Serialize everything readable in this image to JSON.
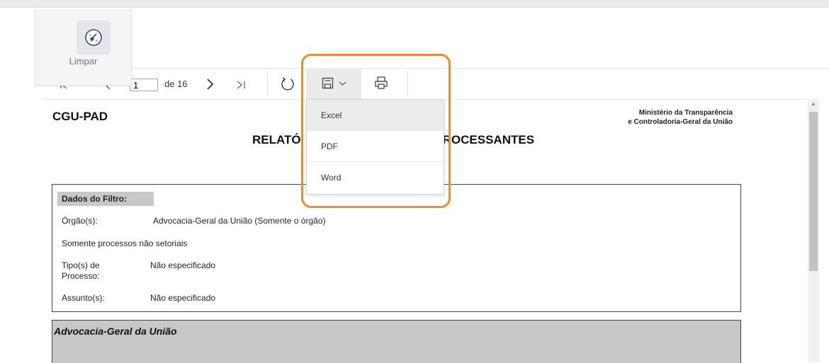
{
  "limpar": {
    "label": "Limpar",
    "icon": "broom-clean-icon"
  },
  "toolbar": {
    "current_page": "1",
    "total_pages": "de 16",
    "icons": [
      "first-page-icon",
      "prev-page-icon",
      "next-page-icon",
      "last-page-icon",
      "refresh-icon",
      "save-icon",
      "chevron-down-icon",
      "print-icon"
    ]
  },
  "export_menu": {
    "items": [
      "Excel",
      "PDF",
      "Word"
    ],
    "hovered": "Excel"
  },
  "report": {
    "header_left": "CGU-PAD",
    "header_right_line1": "Ministério da Transparência",
    "header_right_line2": "e Controladoria-Geral da União",
    "title_left": "RELATÓ",
    "title_right": "ROCESSANTES",
    "filter": {
      "heading": "Dados do Filtro:",
      "orgao_label": "Órgão(s):",
      "orgao_value": "Advocacia-Geral da União (Somente o órgão)",
      "setoriais": "Somente processos não setoriais",
      "tipo_label_1": "Tipo(s) de",
      "tipo_label_2": "Processo:",
      "tipo_value": "Não especificado",
      "assunto_label": "Assunto(s):",
      "assunto_value": "Não especificado"
    },
    "section_title": "Advocacia-Geral da União"
  },
  "colors": {
    "highlight": "#f28a2e",
    "section_bg": "#c8c8c8"
  }
}
